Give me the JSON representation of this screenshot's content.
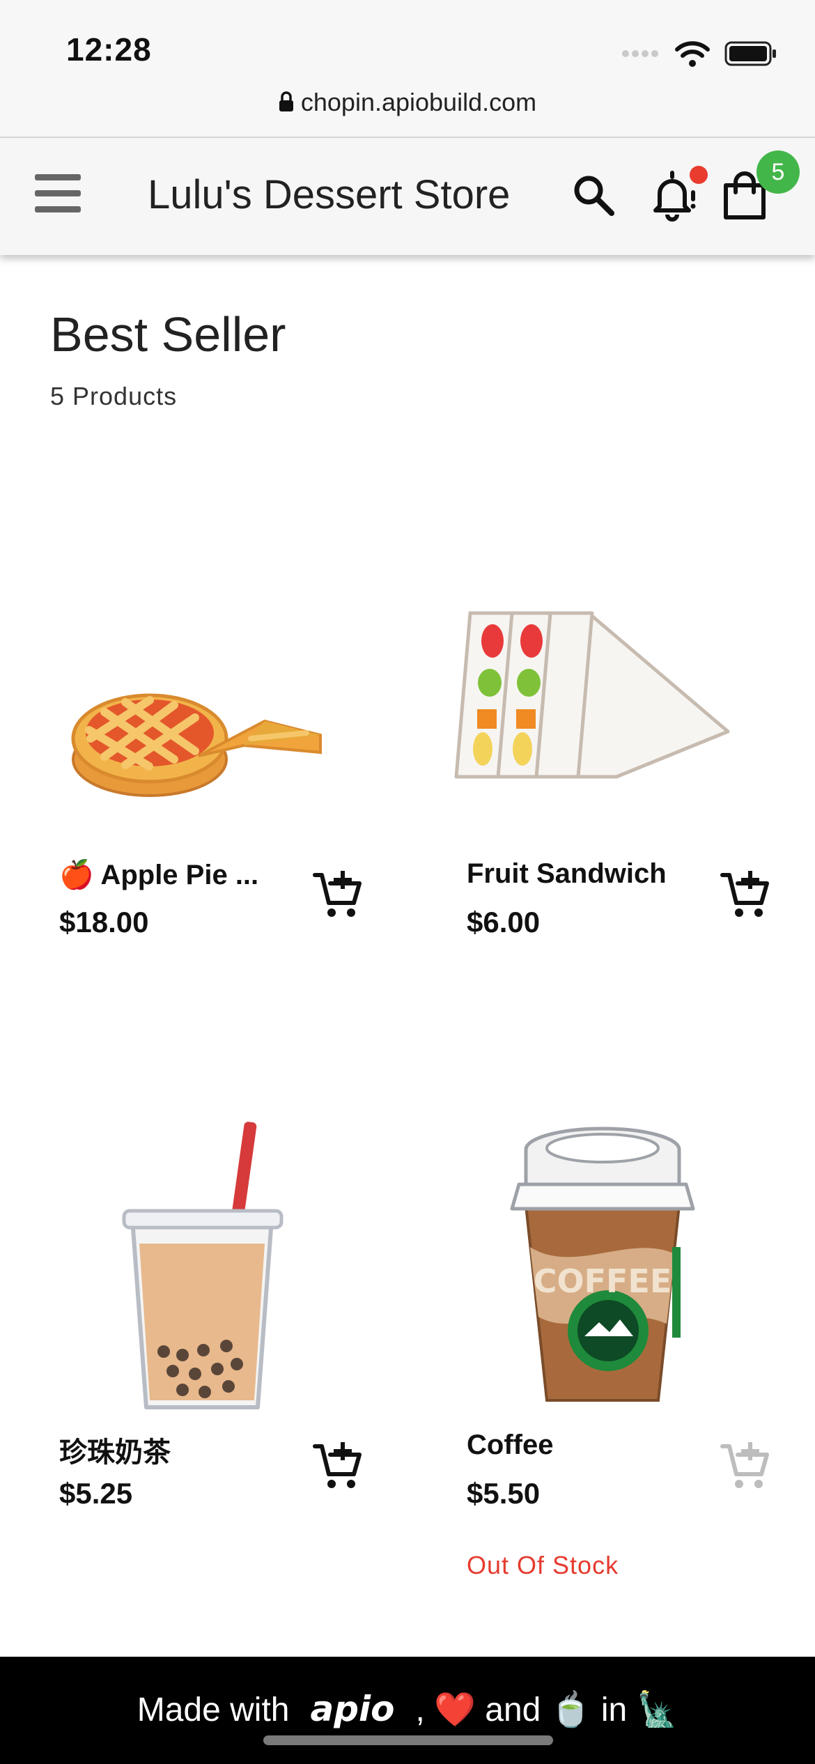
{
  "status_bar": {
    "time": "12:28",
    "url": "chopin.apiobuild.com",
    "icons": [
      "signal-icon",
      "wifi-icon",
      "battery-icon",
      "lock-icon"
    ]
  },
  "header": {
    "store_title": "Lulu's Dessert Store",
    "cart_count": "5",
    "has_notification": true,
    "icons": [
      "menu-icon",
      "search-icon",
      "bell-icon",
      "bag-icon"
    ],
    "colors": {
      "badge": "#43b649",
      "notification_dot": "#ea3b2f"
    }
  },
  "section": {
    "title": "Best Seller",
    "count_text": "5 Products"
  },
  "products": [
    {
      "name": "🍎 Apple Pie ...",
      "price": "$18.00",
      "in_stock": true,
      "image": "apple-pie-illustration"
    },
    {
      "name": "Fruit Sandwich",
      "price": "$6.00",
      "in_stock": true,
      "image": "fruit-sandwich-illustration"
    },
    {
      "name": "珍珠奶茶",
      "price": "$5.25",
      "in_stock": true,
      "image": "bubble-tea-illustration"
    },
    {
      "name": "Coffee",
      "price": "$5.50",
      "in_stock": false,
      "status": "Out Of Stock",
      "image": "coffee-cup-illustration",
      "cup_text": "COFFEE"
    }
  ],
  "footer": {
    "made_with": "Made with",
    "brand": "apio",
    "rest": ", ❤️ and 🍵 in 🗽"
  }
}
